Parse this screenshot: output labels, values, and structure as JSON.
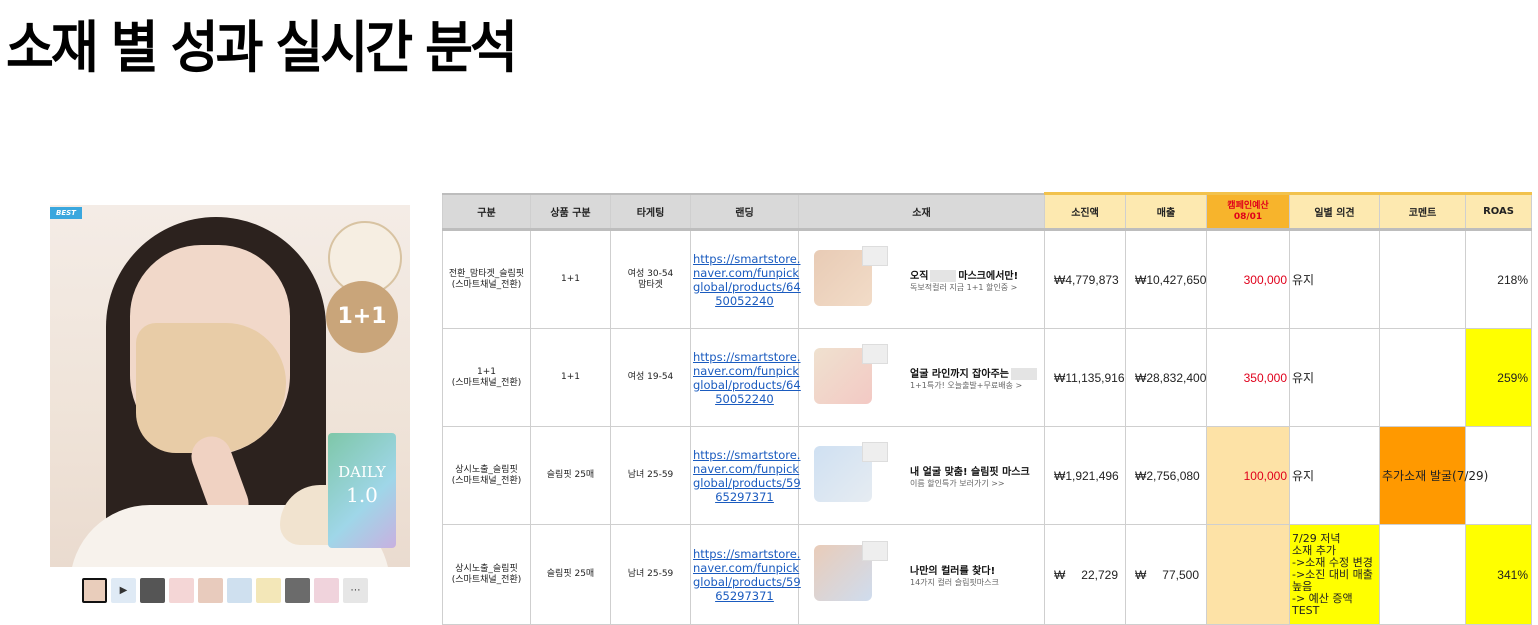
{
  "page": {
    "title": "소재 별 성과 실시간 분석"
  },
  "product": {
    "badge_best": "BEST",
    "badge_promo": "1+1",
    "package_text": "DAILY",
    "package_version": "1.0",
    "thumbnails": [
      "thumb-1",
      "play-icon",
      "thumb-3",
      "thumb-4",
      "thumb-5",
      "thumb-6",
      "thumb-7",
      "thumb-8",
      "thumb-9",
      "more-icon"
    ]
  },
  "table": {
    "headers": {
      "group": "구분",
      "product_type": "상품 구분",
      "targeting": "타게팅",
      "landing": "랜딩",
      "creative": "소재",
      "spend": "소진액",
      "revenue": "매출",
      "budget_line1": "캠페인예산",
      "budget_line2": "08/01",
      "daily_opinion": "일별 의견",
      "comment": "코멘트",
      "roas": "ROAS"
    },
    "rows": [
      {
        "group": "전환_맘타겟_슬림핏\n(스마트채널_전환)",
        "product_type": "1+1",
        "targeting": "여성 30-54\n맘타겟",
        "landing": "https://smartstore.naver.com/funpickglobal/products/6450052240",
        "creative_headline_pre": "오직",
        "creative_headline_post": "마스크에서만!",
        "creative_sub": "독보적컬러 지금 1+1 할인중 >",
        "spend_sym": "₩",
        "spend": "4,779,873",
        "revenue_sym": "₩",
        "revenue": "10,427,650",
        "budget": "300,000",
        "daily_opinion": "유지",
        "comment": "",
        "roas": "218%"
      },
      {
        "group": "1+1\n(스마트채널_전환)",
        "product_type": "1+1",
        "targeting": "여성 19-54",
        "landing": "https://smartstore.naver.com/funpickglobal/products/6450052240",
        "creative_headline_pre": "얼굴 라인까지 잡아주는",
        "creative_headline_post": "",
        "creative_sub": "1+1특가! 오늘출발+무료배송 >",
        "spend_sym": "₩",
        "spend": "11,135,916",
        "revenue_sym": "₩",
        "revenue": "28,832,400",
        "budget": "350,000",
        "daily_opinion": "유지",
        "comment": "",
        "roas": "259%"
      },
      {
        "group": "상시노출_슬림핏\n(스마트채널_전환)",
        "product_type": "슬림핏 25매",
        "targeting": "남녀 25-59",
        "landing": "https://smartstore.naver.com/funpickglobal/products/5965297371",
        "creative_headline_pre": "내 얼굴 맞춤! 슬림핏 마스크",
        "creative_headline_post": "",
        "creative_sub": "이름 할인특가 보러가기 >>",
        "spend_sym": "₩",
        "spend": "1,921,496",
        "revenue_sym": "₩",
        "revenue": "2,756,080",
        "budget": "100,000",
        "daily_opinion": "유지",
        "comment": "추가소재 발굴(7/29)",
        "roas": ""
      },
      {
        "group": "상시노출_슬림핏\n(스마트채널_전환)",
        "product_type": "슬림핏 25매",
        "targeting": "남녀 25-59",
        "landing": "https://smartstore.naver.com/funpickglobal/products/5965297371",
        "creative_headline_pre": "나만의 컬러를 찾다!",
        "creative_headline_post": "",
        "creative_sub": "14가지 컬러 슬림핏마스크",
        "spend_sym": "₩",
        "spend": "22,729",
        "revenue_sym": "₩",
        "revenue": "77,500",
        "budget": "",
        "daily_opinion": "7/29 저녁\n소재 추가\n->소재 수정 변경\n->소진 대비 매출 높음\n-> 예산 증액TEST",
        "comment": "",
        "roas": "341%"
      }
    ],
    "landing_display": [
      "https://smartstore.\nnaver.com/funpick\nglobal/products/64\n50052240",
      "https://smartstore.\nnaver.com/funpick\nglobal/products/64\n50052240",
      "https://smartstore.\nnaver.com/funpick\nglobal/products/59\n65297371",
      "https://smartstore.\nnaver.com/funpick\nglobal/products/59\n65297371"
    ]
  },
  "colors": {
    "header_gray": "#d9d9d9",
    "header_highlight": "#fde9b0",
    "budget_header": "#f7b42c",
    "budget_text": "#e0001b",
    "peach_cell": "#fde2a6",
    "yellow_cell": "#ffff00",
    "orange_cell": "#ff9900",
    "link": "#1a5bbf"
  }
}
